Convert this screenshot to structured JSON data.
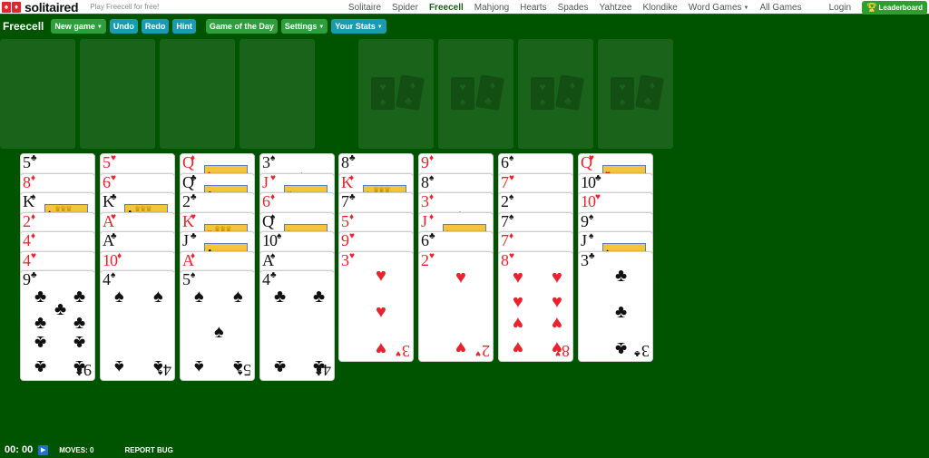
{
  "site": {
    "logo_text": "solitaired",
    "logo_suits": [
      "♠",
      "♦"
    ],
    "tagline": "Play Freecell for free!"
  },
  "nav": {
    "items": [
      {
        "label": "Solitaire",
        "active": false
      },
      {
        "label": "Spider",
        "active": false
      },
      {
        "label": "Freecell",
        "active": true
      },
      {
        "label": "Mahjong",
        "active": false
      },
      {
        "label": "Hearts",
        "active": false
      },
      {
        "label": "Spades",
        "active": false
      },
      {
        "label": "Yahtzee",
        "active": false
      },
      {
        "label": "Klondike",
        "active": false
      },
      {
        "label": "Word Games",
        "active": false,
        "dropdown": true
      },
      {
        "label": "All Games",
        "active": false
      }
    ],
    "login": "Login",
    "leaderboard": "Leaderboard",
    "leaderboard_icon": "trophy-icon"
  },
  "toolbar": {
    "title": "Freecell",
    "new_game": "New game",
    "undo": "Undo",
    "redo": "Redo",
    "hint": "Hint",
    "game_of_day": "Game of the Day",
    "settings": "Settings",
    "your_stats": "Your Stats"
  },
  "colors": {
    "table": "#005400",
    "slot": "#1a631a",
    "green_button": "#2f9e3c",
    "teal_button": "#1b9bb0",
    "red_suit": "#e8232e",
    "black_suit": "#111111"
  },
  "free_cells": [
    null,
    null,
    null,
    null
  ],
  "foundations": [
    null,
    null,
    null,
    null
  ],
  "tableau": [
    [
      {
        "r": "5",
        "s": "♣"
      },
      {
        "r": "8",
        "s": "♦"
      },
      {
        "r": "K",
        "s": "♠"
      },
      {
        "r": "2",
        "s": "♦"
      },
      {
        "r": "4",
        "s": "♦"
      },
      {
        "r": "4",
        "s": "♥"
      },
      {
        "r": "9",
        "s": "♣"
      }
    ],
    [
      {
        "r": "5",
        "s": "♥"
      },
      {
        "r": "6",
        "s": "♥"
      },
      {
        "r": "K",
        "s": "♣"
      },
      {
        "r": "A",
        "s": "♥"
      },
      {
        "r": "A",
        "s": "♣"
      },
      {
        "r": "10",
        "s": "♦"
      },
      {
        "r": "4",
        "s": "♠"
      }
    ],
    [
      {
        "r": "Q",
        "s": "♦"
      },
      {
        "r": "Q",
        "s": "♣"
      },
      {
        "r": "2",
        "s": "♣"
      },
      {
        "r": "K",
        "s": "♥"
      },
      {
        "r": "J",
        "s": "♣"
      },
      {
        "r": "A",
        "s": "♦"
      },
      {
        "r": "5",
        "s": "♠"
      }
    ],
    [
      {
        "r": "3",
        "s": "♠"
      },
      {
        "r": "J",
        "s": "♥"
      },
      {
        "r": "6",
        "s": "♦"
      },
      {
        "r": "Q",
        "s": "♠"
      },
      {
        "r": "10",
        "s": "♠"
      },
      {
        "r": "A",
        "s": "♠"
      },
      {
        "r": "4",
        "s": "♣"
      }
    ],
    [
      {
        "r": "8",
        "s": "♣"
      },
      {
        "r": "K",
        "s": "♦"
      },
      {
        "r": "7",
        "s": "♣"
      },
      {
        "r": "5",
        "s": "♦"
      },
      {
        "r": "9",
        "s": "♥"
      },
      {
        "r": "3",
        "s": "♥"
      }
    ],
    [
      {
        "r": "9",
        "s": "♦"
      },
      {
        "r": "8",
        "s": "♠"
      },
      {
        "r": "3",
        "s": "♦"
      },
      {
        "r": "J",
        "s": "♦"
      },
      {
        "r": "6",
        "s": "♣"
      },
      {
        "r": "2",
        "s": "♥"
      }
    ],
    [
      {
        "r": "6",
        "s": "♠"
      },
      {
        "r": "7",
        "s": "♥"
      },
      {
        "r": "2",
        "s": "♠"
      },
      {
        "r": "7",
        "s": "♠"
      },
      {
        "r": "7",
        "s": "♦"
      },
      {
        "r": "8",
        "s": "♥"
      }
    ],
    [
      {
        "r": "Q",
        "s": "♥"
      },
      {
        "r": "10",
        "s": "♣"
      },
      {
        "r": "10",
        "s": "♥"
      },
      {
        "r": "9",
        "s": "♠"
      },
      {
        "r": "J",
        "s": "♠"
      },
      {
        "r": "3",
        "s": "♣"
      }
    ]
  ],
  "footer": {
    "timer": "00: 00",
    "play_icon": "play-icon",
    "moves_label": "MOVES:",
    "moves": "0",
    "report_bug": "REPORT BUG"
  }
}
